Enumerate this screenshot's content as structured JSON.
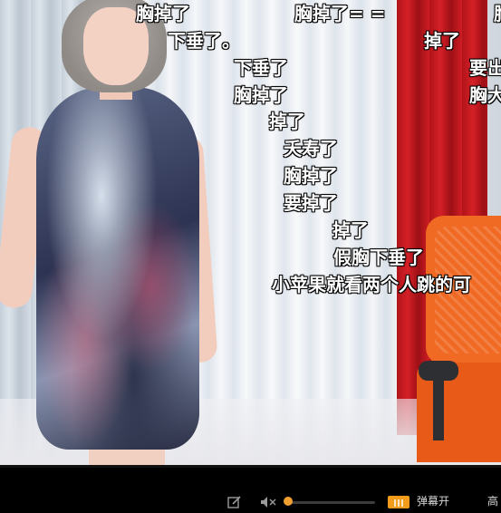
{
  "danmaku": [
    {
      "id": "d1",
      "text": "胸掉了"
    },
    {
      "id": "d2",
      "text": "胸掉了= ="
    },
    {
      "id": "d3",
      "text": "下垂了。"
    },
    {
      "id": "d4",
      "text": "掉了"
    },
    {
      "id": "d5",
      "text": "下垂了"
    },
    {
      "id": "d6",
      "text": "要出"
    },
    {
      "id": "d7",
      "text": "胸掉了"
    },
    {
      "id": "d8",
      "text": "胸大"
    },
    {
      "id": "d9",
      "text": "掉了"
    },
    {
      "id": "d10",
      "text": "夭寿了"
    },
    {
      "id": "d11",
      "text": "胸掉了"
    },
    {
      "id": "d12",
      "text": "要掉了"
    },
    {
      "id": "d13",
      "text": "掉了"
    },
    {
      "id": "d14",
      "text": "假胸下垂了"
    },
    {
      "id": "d15",
      "text": "小苹果就看两个人跳的可"
    },
    {
      "id": "d16",
      "text": "胸"
    }
  ],
  "controls": {
    "danmaku_toggle_label": "弹幕开",
    "corner_label": "高",
    "icons": [
      "edit-icon",
      "mute-icon",
      "danmaku-icon"
    ]
  },
  "colors": {
    "danmaku_text": "#ffffff",
    "accent": "#f39b1a"
  }
}
